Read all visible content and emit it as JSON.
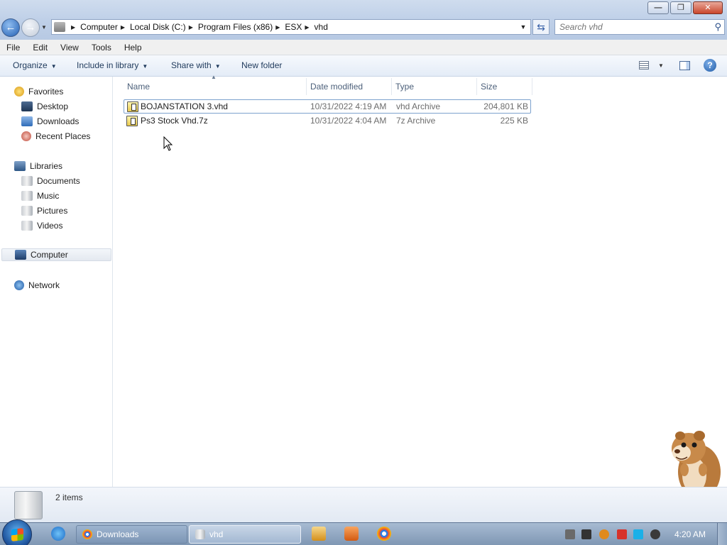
{
  "window": {
    "minimize_glyph": "—",
    "restore_glyph": "❐",
    "close_glyph": "✕"
  },
  "address": {
    "crumbs": [
      "Computer",
      "Local Disk (C:)",
      "Program Files (x86)",
      "ESX",
      "vhd"
    ]
  },
  "search": {
    "placeholder": "Search vhd"
  },
  "menu": [
    "File",
    "Edit",
    "View",
    "Tools",
    "Help"
  ],
  "toolbar": {
    "organize": "Organize",
    "include_in_library": "Include in library",
    "share_with": "Share with",
    "new_folder": "New folder",
    "help_glyph": "?"
  },
  "nav": {
    "favorites": "Favorites",
    "favorites_items": [
      "Desktop",
      "Downloads",
      "Recent Places"
    ],
    "libraries": "Libraries",
    "library_items": [
      "Documents",
      "Music",
      "Pictures",
      "Videos"
    ],
    "computer": "Computer",
    "network": "Network"
  },
  "columns": {
    "name": "Name",
    "date": "Date modified",
    "type": "Type",
    "size": "Size"
  },
  "files": [
    {
      "name": "BOJANSTATION 3.vhd",
      "date": "10/31/2022 4:19 AM",
      "type": "vhd Archive",
      "size": "204,801 KB"
    },
    {
      "name": "Ps3 Stock Vhd.7z",
      "date": "10/31/2022 4:04 AM",
      "type": "7z Archive",
      "size": "225 KB"
    }
  ],
  "details": {
    "count": "2 items"
  },
  "taskbar": {
    "buttons": [
      "Downloads",
      "vhd"
    ],
    "clock": "4:20 AM"
  },
  "colors": {
    "accent": "#2460b3",
    "titlebar": "#bfd0e8",
    "taskbar": "#8ea5c1"
  }
}
